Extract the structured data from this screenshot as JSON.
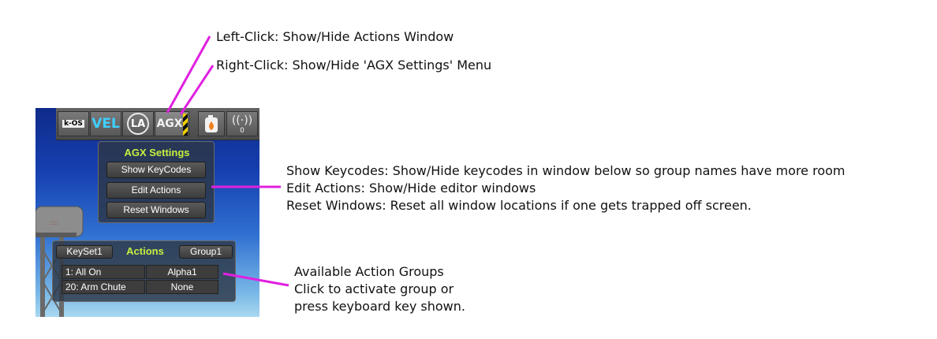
{
  "annotations": {
    "left_click": "Left-Click: Show/Hide Actions Window",
    "right_click": "Right-Click: Show/Hide 'AGX Settings' Menu",
    "settings_lines": [
      "Show Keycodes: Show/Hide keycodes in window below so group names have more room",
      "Edit Actions: Show/Hide editor windows",
      "Reset Windows: Reset all window locations if one gets trapped off screen."
    ],
    "groups_lines": [
      "Available Action Groups",
      "Click to activate group or",
      "press keyboard key shown."
    ]
  },
  "toolbar": {
    "kos_label": "k-OS",
    "vel_label": "VEL",
    "la_label": "LA",
    "agx_label": "AGX",
    "antenna_count": "0"
  },
  "settings_window": {
    "title": "AGX Settings",
    "buttons": [
      "Show KeyCodes",
      "Edit Actions",
      "Reset Windows"
    ]
  },
  "actions_window": {
    "keyset_label": "KeySet1",
    "title": "Actions",
    "group_label": "Group1",
    "rows": [
      {
        "key": "1: All On",
        "group": "Alpha1"
      },
      {
        "key": "20: Arm Chute",
        "group": "None"
      }
    ]
  },
  "colors": {
    "callout_line": "#e020e0",
    "title_green": "#c6f040",
    "vel_cyan": "#3fd0ff"
  }
}
